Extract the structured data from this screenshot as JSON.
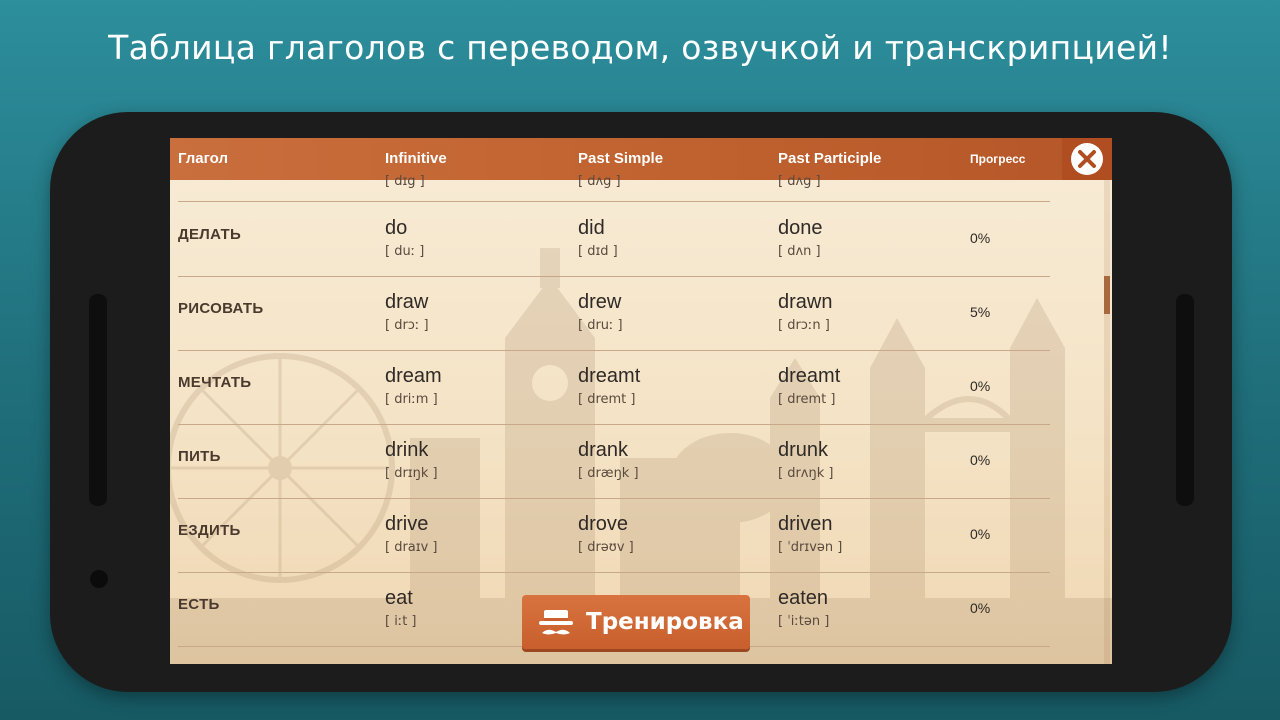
{
  "banner": {
    "title": "Таблица глаголов с переводом, озвучкой и транскрипцией!"
  },
  "header": {
    "verb": "Глагол",
    "infinitive": "Infinitive",
    "past_simple": "Past Simple",
    "past_participle": "Past Participle",
    "progress": "Прогресс"
  },
  "partial_row": {
    "tr1": "[ dɪg ]",
    "tr2": "[ dʌg ]",
    "tr3": "[ dʌg ]"
  },
  "rows": [
    {
      "verb": "ДЕЛАТЬ",
      "inf": "do",
      "inf_tr": "[ duː ]",
      "ps": "did",
      "ps_tr": "[ dɪd ]",
      "pp": "done",
      "pp_tr": "[ dʌn ]",
      "progress": "0%"
    },
    {
      "verb": "РИСОВАТЬ",
      "inf": "draw",
      "inf_tr": "[ drɔː ]",
      "ps": "drew",
      "ps_tr": "[ druː ]",
      "pp": "drawn",
      "pp_tr": "[ drɔːn ]",
      "progress": "5%"
    },
    {
      "verb": "МЕЧТАТЬ",
      "inf": "dream",
      "inf_tr": "[ driːm ]",
      "ps": "dreamt",
      "ps_tr": "[ dremt ]",
      "pp": "dreamt",
      "pp_tr": "[ dremt ]",
      "progress": "0%"
    },
    {
      "verb": "ПИТЬ",
      "inf": "drink",
      "inf_tr": "[ drɪŋk ]",
      "ps": "drank",
      "ps_tr": "[ dræŋk ]",
      "pp": "drunk",
      "pp_tr": "[ drʌŋk ]",
      "progress": "0%"
    },
    {
      "verb": "ЕЗДИТЬ",
      "inf": "drive",
      "inf_tr": "[ draɪv ]",
      "ps": "drove",
      "ps_tr": "[ drəʊv ]",
      "pp": "driven",
      "pp_tr": "[ ˈdrɪvən ]",
      "progress": "0%"
    },
    {
      "verb": "ЕСТЬ",
      "inf": "eat",
      "inf_tr": "[ iːt ]",
      "ps": "",
      "ps_tr": "",
      "pp": "eaten",
      "pp_tr": "[ ˈiːtən ]",
      "progress": "0%"
    }
  ],
  "train_button": {
    "label": "Тренировка",
    "icon": "hat-mustache-icon"
  },
  "close_button": {
    "icon": "close-icon"
  },
  "colors": {
    "accent": "#c96e3d",
    "background": "#2d8e9c",
    "paper": "#f6e6c9"
  }
}
